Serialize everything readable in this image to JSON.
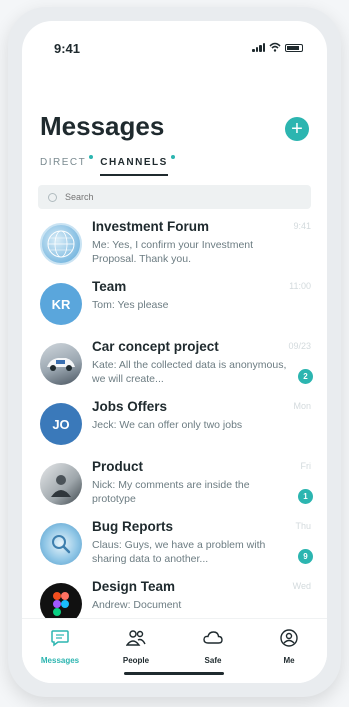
{
  "status": {
    "time": "9:41"
  },
  "header": {
    "title": "Messages",
    "add_label": "+"
  },
  "tabs": [
    {
      "label": "DIRECT",
      "active": false
    },
    {
      "label": "CHANNELS",
      "active": true
    }
  ],
  "search": {
    "placeholder": "Search"
  },
  "conversations": [
    {
      "title": "Investment Forum",
      "preview": "Me: Yes, I confirm your Investment Proposal. Thank you.",
      "time": "9:41",
      "badge": "",
      "avatar": "globe"
    },
    {
      "title": "Team",
      "preview": "Tom: Yes please",
      "time": "11:00",
      "badge": "",
      "avatar_text": "KR",
      "avatar_color": "#5aa6dc"
    },
    {
      "title": "Car concept project",
      "preview": "Kate: All the collected data is anonymous, we will create...",
      "time": "09/23",
      "badge": "2",
      "avatar": "car"
    },
    {
      "title": "Jobs Offers",
      "preview": "Jeck: We can offer only two jobs",
      "time": "Mon",
      "badge": "",
      "avatar_text": "JO",
      "avatar_color": "#3a79ba"
    },
    {
      "title": "Product",
      "preview": "Nick: My comments are inside the prototype",
      "time": "Fri",
      "badge": "1",
      "avatar": "product"
    },
    {
      "title": "Bug Reports",
      "preview": "Claus: Guys, we have a problem with sharing data to another...",
      "time": "Thu",
      "badge": "9",
      "avatar": "bug"
    },
    {
      "title": "Design Team",
      "preview": "Andrew: Document",
      "time": "Wed",
      "badge": "",
      "avatar": "figma"
    }
  ],
  "tabbar": [
    {
      "label": "Messages",
      "icon": "chat-icon",
      "active": true
    },
    {
      "label": "People",
      "icon": "people-icon",
      "active": false
    },
    {
      "label": "Safe",
      "icon": "cloud-icon",
      "active": false
    },
    {
      "label": "Me",
      "icon": "user-icon",
      "active": false
    }
  ],
  "colors": {
    "accent": "#2cb5b0",
    "text": "#1f2a2e"
  }
}
